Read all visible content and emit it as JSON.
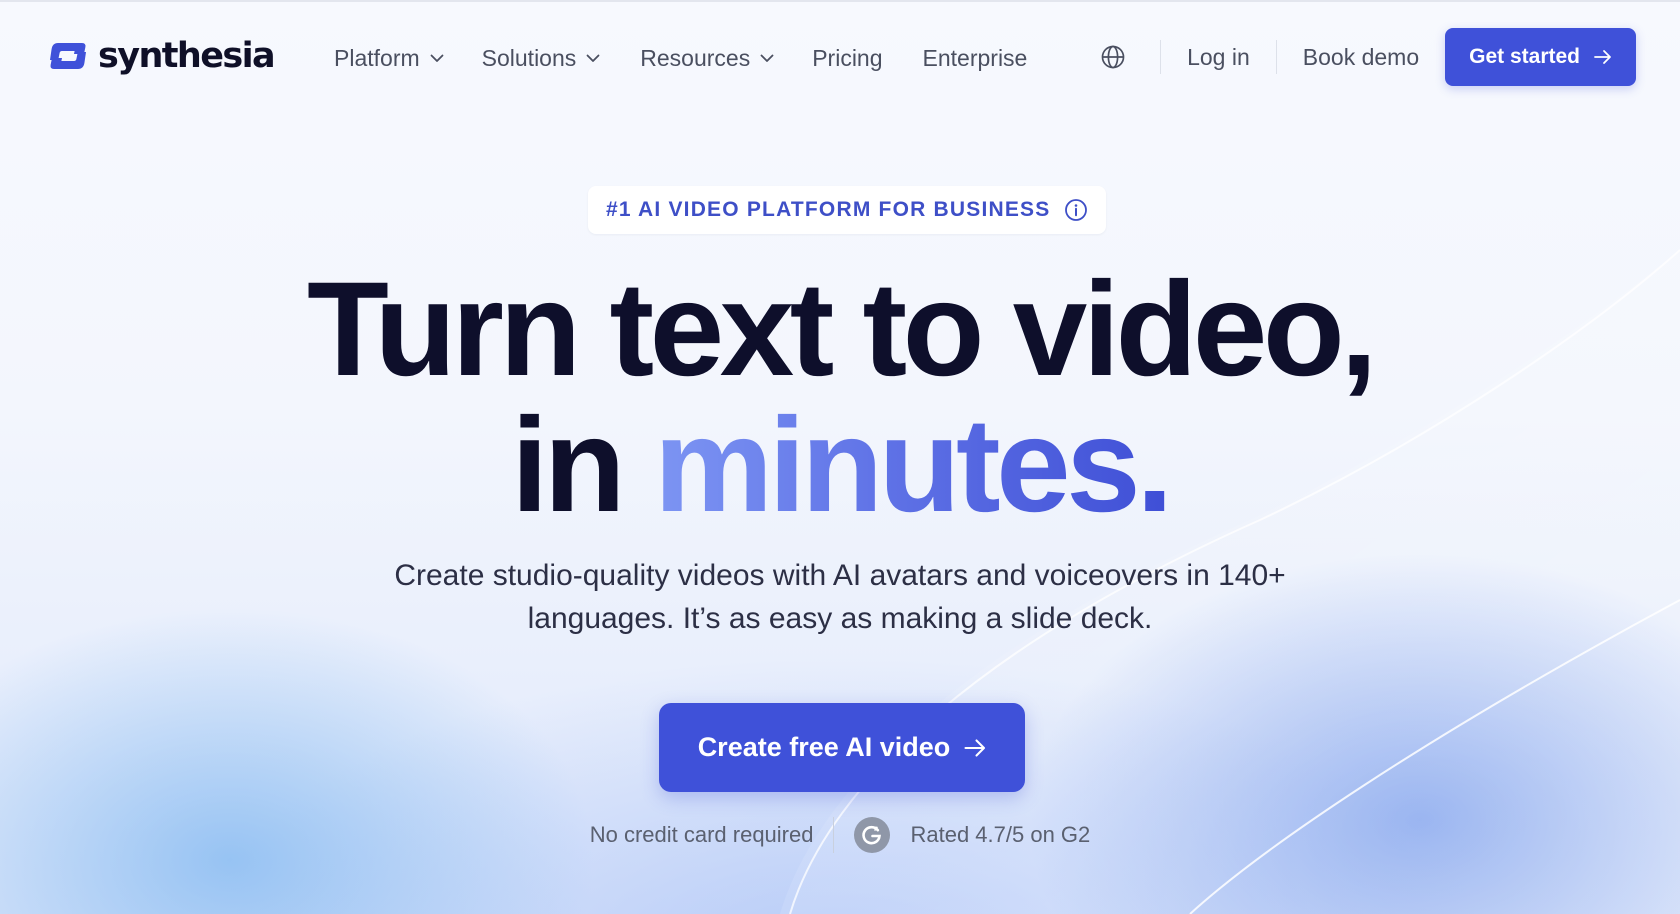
{
  "brand": {
    "name": "synthesia",
    "accent_color": "#3f51d9"
  },
  "nav": {
    "items": [
      {
        "label": "Platform",
        "has_dropdown": true
      },
      {
        "label": "Solutions",
        "has_dropdown": true
      },
      {
        "label": "Resources",
        "has_dropdown": true
      },
      {
        "label": "Pricing",
        "has_dropdown": false
      },
      {
        "label": "Enterprise",
        "has_dropdown": false
      }
    ],
    "globe_icon": "globe-icon",
    "login_label": "Log in",
    "book_demo_label": "Book demo",
    "get_started_label": "Get started"
  },
  "hero": {
    "badge": "#1 AI VIDEO PLATFORM FOR BUSINESS",
    "headline_line1": "Turn text to video,",
    "headline_line2_prefix": "in ",
    "headline_line2_accent": "minutes.",
    "subhead_line1": "Create studio-quality videos with AI avatars and voiceovers in 140+",
    "subhead_line2": "languages. It’s as easy as making a slide deck.",
    "cta_label": "Create free AI video",
    "note_left": "No credit card required",
    "note_right": "Rated 4.7/5 on G2"
  }
}
